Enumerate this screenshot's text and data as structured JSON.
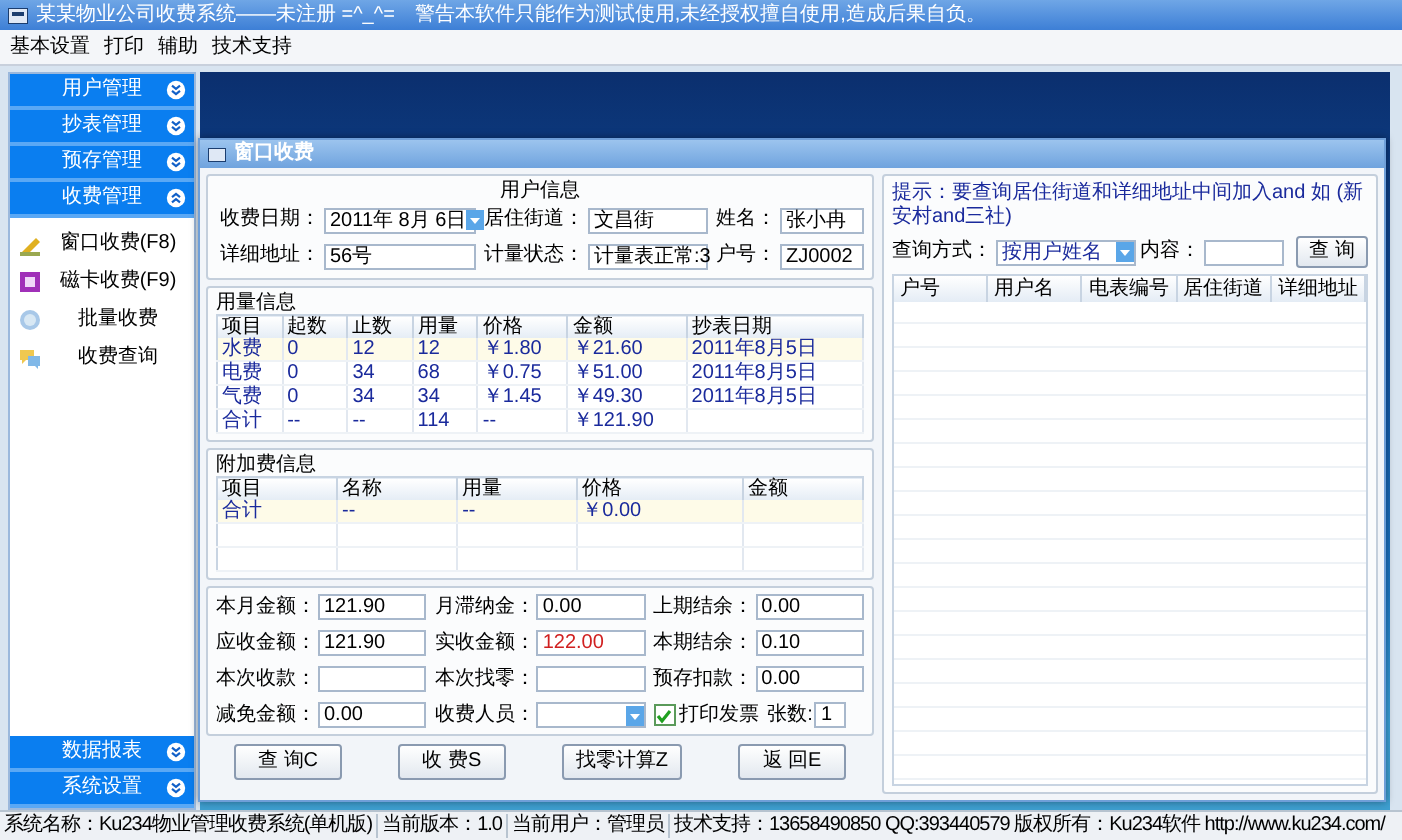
{
  "window": {
    "title": "某某物业公司收费系统——未注册 =^_^=　警告本软件只能作为测试使用,未经授权擅自使用,造成后果自负。"
  },
  "menu": [
    "基本设置",
    "打印",
    "辅助",
    "技术支持"
  ],
  "sidebar": {
    "groups": [
      {
        "label": "用户管理",
        "expanded": false
      },
      {
        "label": "抄表管理",
        "expanded": false
      },
      {
        "label": "预存管理",
        "expanded": false
      },
      {
        "label": "收费管理",
        "expanded": true,
        "items": [
          {
            "label": "窗口收费(F8)"
          },
          {
            "label": "磁卡收费(F9)"
          },
          {
            "label": "批量收费"
          },
          {
            "label": "收费查询"
          }
        ]
      },
      {
        "label": "数据报表",
        "expanded": false
      },
      {
        "label": "系统设置",
        "expanded": false
      }
    ]
  },
  "dialog": {
    "title": "窗口收费",
    "user_info": {
      "title": "用户信息",
      "rows": [
        [
          {
            "label": "收费日期：",
            "value": "2011年 8月 6日",
            "kind": "dropdown"
          },
          {
            "label": "居住街道：",
            "value": "文昌街",
            "kind": "text"
          },
          {
            "label": "姓名：",
            "value": "张小冉",
            "kind": "text"
          }
        ],
        [
          {
            "label": "详细地址：",
            "value": "56号",
            "kind": "text"
          },
          {
            "label": "计量状态：",
            "value": "计量表正常:3",
            "kind": "text"
          },
          {
            "label": "户号：",
            "value": "ZJ0002",
            "kind": "text"
          }
        ]
      ]
    },
    "usage": {
      "title": "用量信息",
      "columns": [
        "项目",
        "起数",
        "止数",
        "用量",
        "价格",
        "金额",
        "抄表日期"
      ],
      "rows": [
        [
          "水费",
          "0",
          "12",
          "12",
          "￥1.80",
          "￥21.60",
          "2011年8月5日"
        ],
        [
          "电费",
          "0",
          "34",
          "68",
          "￥0.75",
          "￥51.00",
          "2011年8月5日"
        ],
        [
          "气费",
          "0",
          "34",
          "34",
          "￥1.45",
          "￥49.30",
          "2011年8月5日"
        ],
        [
          "合计",
          "--",
          "--",
          "114",
          "--",
          "￥121.90"
        ]
      ]
    },
    "extra": {
      "title": "附加费信息",
      "columns": [
        "项目",
        "名称",
        "用量",
        "价格",
        "金额"
      ],
      "rows": [
        [
          "合计",
          "--",
          "--",
          "￥0.00"
        ]
      ]
    },
    "amounts": {
      "fields": [
        {
          "label": "本月金额：",
          "value": "121.90",
          "kind": "text",
          "emphasized": false
        },
        {
          "label": "月滞纳金：",
          "value": "0.00",
          "kind": "text",
          "emphasized": false
        },
        {
          "label": "上期结余：",
          "value": "0.00",
          "kind": "text",
          "emphasized": false
        },
        {
          "label": "应收金额：",
          "value": "121.90",
          "kind": "text",
          "emphasized": false
        },
        {
          "label": "实收金额：",
          "value": "122.00",
          "kind": "text",
          "emphasized": true
        },
        {
          "label": "本期结余：",
          "value": "0.10",
          "kind": "text",
          "emphasized": false
        },
        {
          "label": "本次收款：",
          "kind": "text"
        },
        {
          "label": "本次找零：",
          "kind": "text"
        },
        {
          "label": "预存扣款：",
          "value": "0.00",
          "kind": "text",
          "emphasized": false
        },
        {
          "label": "减免金额：",
          "value": "0.00",
          "kind": "text",
          "emphasized": false
        },
        {
          "label": "收费人员：",
          "kind": "dropdown"
        },
        {
          "label": "打印发票",
          "kind": "checkbox",
          "checked": true,
          "count_label": "张数:",
          "count": "1"
        }
      ]
    },
    "buttons": [
      "查 询C",
      "收 费S",
      "找零计算Z",
      "返 回E"
    ],
    "search": {
      "hint": "提示：要查询居住街道和详细地址中间加入and 如 (新安村and三社)",
      "mode_label": "查询方式：",
      "mode": "按用户姓名",
      "content_label": "内容：",
      "button": "查 询",
      "columns": [
        "户号",
        "用户名",
        "电表编号",
        "居住街道",
        "详细地址"
      ]
    }
  },
  "status_bar": [
    "系统名称：Ku234物业管理收费系统(单机版)",
    "当前版本：1.0",
    "当前用户：管理员",
    "技术支持：13658490850 QQ:393440579 版权所有：Ku234软件 http://www.ku234.com/"
  ]
}
